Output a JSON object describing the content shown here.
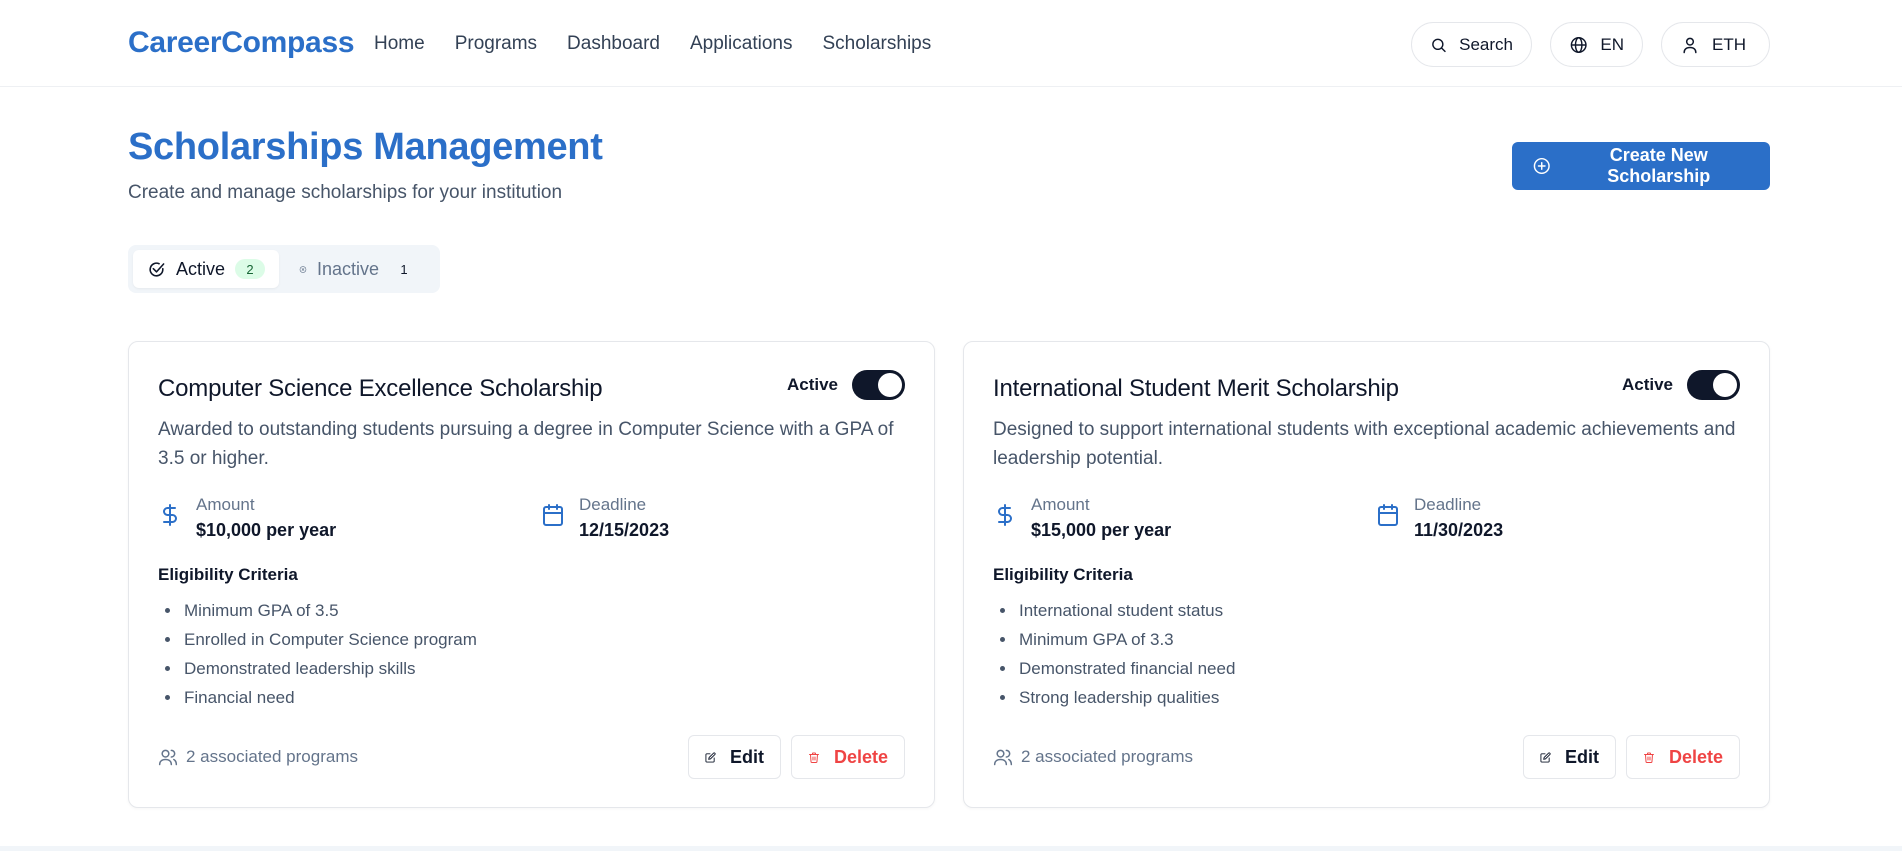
{
  "header": {
    "brand": "CareerCompass",
    "nav": [
      "Home",
      "Programs",
      "Dashboard",
      "Applications",
      "Scholarships"
    ],
    "search_label": "Search",
    "language": "EN",
    "user": "ETH"
  },
  "page": {
    "title": "Scholarships Management",
    "subtitle": "Create and manage scholarships for your institution",
    "create_button": "Create New Scholarship"
  },
  "tabs": {
    "active": {
      "label": "Active",
      "count": "2"
    },
    "inactive": {
      "label": "Inactive",
      "count": "1"
    }
  },
  "scholarships": [
    {
      "title": "Computer Science Excellence Scholarship",
      "status": "Active",
      "enabled": true,
      "description": "Awarded to outstanding students pursuing a degree in Computer Science with a GPA of 3.5 or higher.",
      "amount_label": "Amount",
      "amount": "$10,000 per year",
      "deadline_label": "Deadline",
      "deadline": "12/15/2023",
      "eligibility_title": "Eligibility Criteria",
      "criteria": [
        "Minimum GPA of 3.5",
        "Enrolled in Computer Science program",
        "Demonstrated leadership skills",
        "Financial need"
      ],
      "programs": "2 associated programs",
      "edit": "Edit",
      "delete": "Delete"
    },
    {
      "title": "International Student Merit Scholarship",
      "status": "Active",
      "enabled": true,
      "description": "Designed to support international students with exceptional academic achievements and leadership potential.",
      "amount_label": "Amount",
      "amount": "$15,000 per year",
      "deadline_label": "Deadline",
      "deadline": "11/30/2023",
      "eligibility_title": "Eligibility Criteria",
      "criteria": [
        "International student status",
        "Minimum GPA of 3.3",
        "Demonstrated financial need",
        "Strong leadership qualities"
      ],
      "programs": "2 associated programs",
      "edit": "Edit",
      "delete": "Delete"
    }
  ],
  "colors": {
    "brand": "#2b6fc8",
    "toggle_on": "#0f172a",
    "delete": "#ef4444",
    "badge_active_bg": "#dcfce7"
  },
  "icons": {
    "search": "search-icon",
    "language": "globe-icon",
    "user": "user-icon",
    "create": "plus-circle-icon",
    "tab_active": "check-circle-icon",
    "tab_inactive": "x-circle-icon",
    "amount": "dollar-icon",
    "deadline": "calendar-icon",
    "programs": "users-icon",
    "edit": "edit-icon",
    "delete": "trash-icon"
  }
}
